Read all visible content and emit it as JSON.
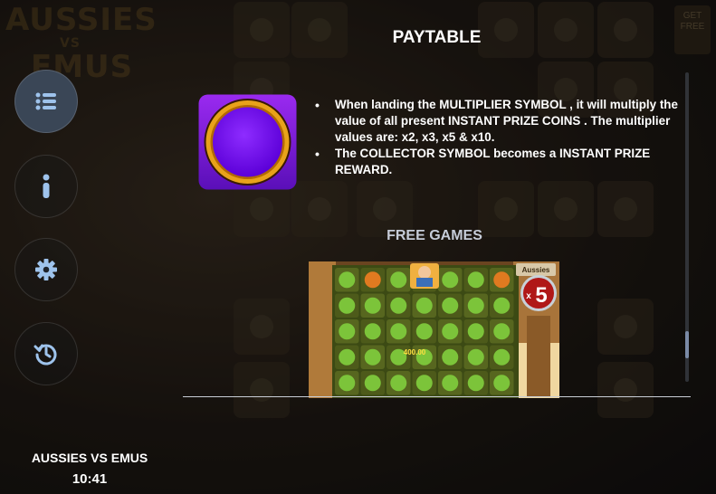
{
  "game": {
    "name": "AUSSIES VS EMUS",
    "time": "10:41"
  },
  "background": {
    "logo_line1": "AUSSIES",
    "logo_line2": "VS",
    "logo_line3": "EMUS",
    "get_free": "GET FREE"
  },
  "menu": {
    "items": [
      {
        "name": "paytable",
        "icon": "list-icon",
        "active": true
      },
      {
        "name": "info",
        "icon": "info-icon",
        "active": false
      },
      {
        "name": "settings",
        "icon": "gear-icon",
        "active": false
      },
      {
        "name": "history",
        "icon": "history-icon",
        "active": false
      }
    ]
  },
  "paytable": {
    "title": "PAYTABLE",
    "symbol_icon": "multiplier-coin-icon",
    "rules": [
      "When landing the MULTIPLIER SYMBOL , it will multiply the value of all present INSTANT PRIZE COINS . The multiplier values are: x2, x3, x5 & x10.",
      "The COLLECTOR SYMBOL becomes a INSTANT PRIZE REWARD."
    ],
    "free_games_title": "FREE GAMES",
    "free_games_image": {
      "logo": "Aussies",
      "multiplier": "5",
      "multiplier_prefix": "x",
      "prize_text": "400.00"
    }
  },
  "colors": {
    "accent_purple": "#7a1de0",
    "coin_gold": "#e8a21a",
    "menu_active": "#3a4656",
    "icon_blue": "#9ec3ec"
  }
}
